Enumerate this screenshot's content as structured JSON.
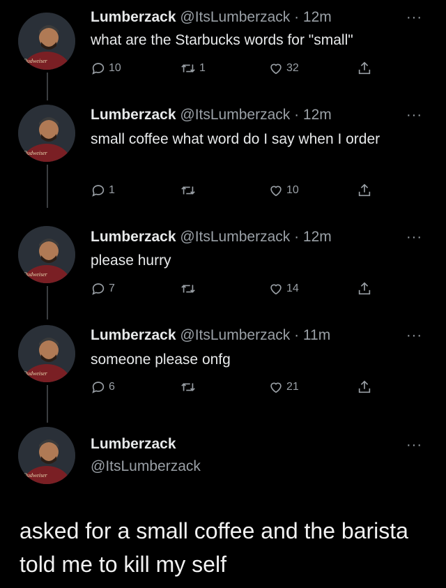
{
  "tweets": [
    {
      "name": "Lumberzack",
      "handle": "@ItsLumberzack",
      "time": "· 12m",
      "text": "what are the Starbucks words for \"small\"",
      "replies": "10",
      "retweets": "1",
      "likes": "32"
    },
    {
      "name": "Lumberzack",
      "handle": "@ItsLumberzack",
      "time": "· 12m",
      "text": "small coffee what word do I say when I order",
      "replies": "1",
      "retweets": "",
      "likes": "10"
    },
    {
      "name": "Lumberzack",
      "handle": "@ItsLumberzack",
      "time": "· 12m",
      "text": "please hurry",
      "replies": "7",
      "retweets": "",
      "likes": "14"
    },
    {
      "name": "Lumberzack",
      "handle": "@ItsLumberzack",
      "time": "· 11m",
      "text": "someone please onfg",
      "replies": "6",
      "retweets": "",
      "likes": "21"
    }
  ],
  "final_tweet": {
    "name": "Lumberzack",
    "handle": "@ItsLumberzack"
  },
  "more_label": "···",
  "caption": "asked for a small coffee and the barista told me to kill my self",
  "colors": {
    "background": "#000000",
    "text": "#e7e9ea",
    "muted": "#9aa0a6"
  },
  "icons": {
    "reply": "reply-icon",
    "retweet": "retweet-icon",
    "like": "heart-icon",
    "share": "share-icon",
    "more": "more-icon"
  }
}
